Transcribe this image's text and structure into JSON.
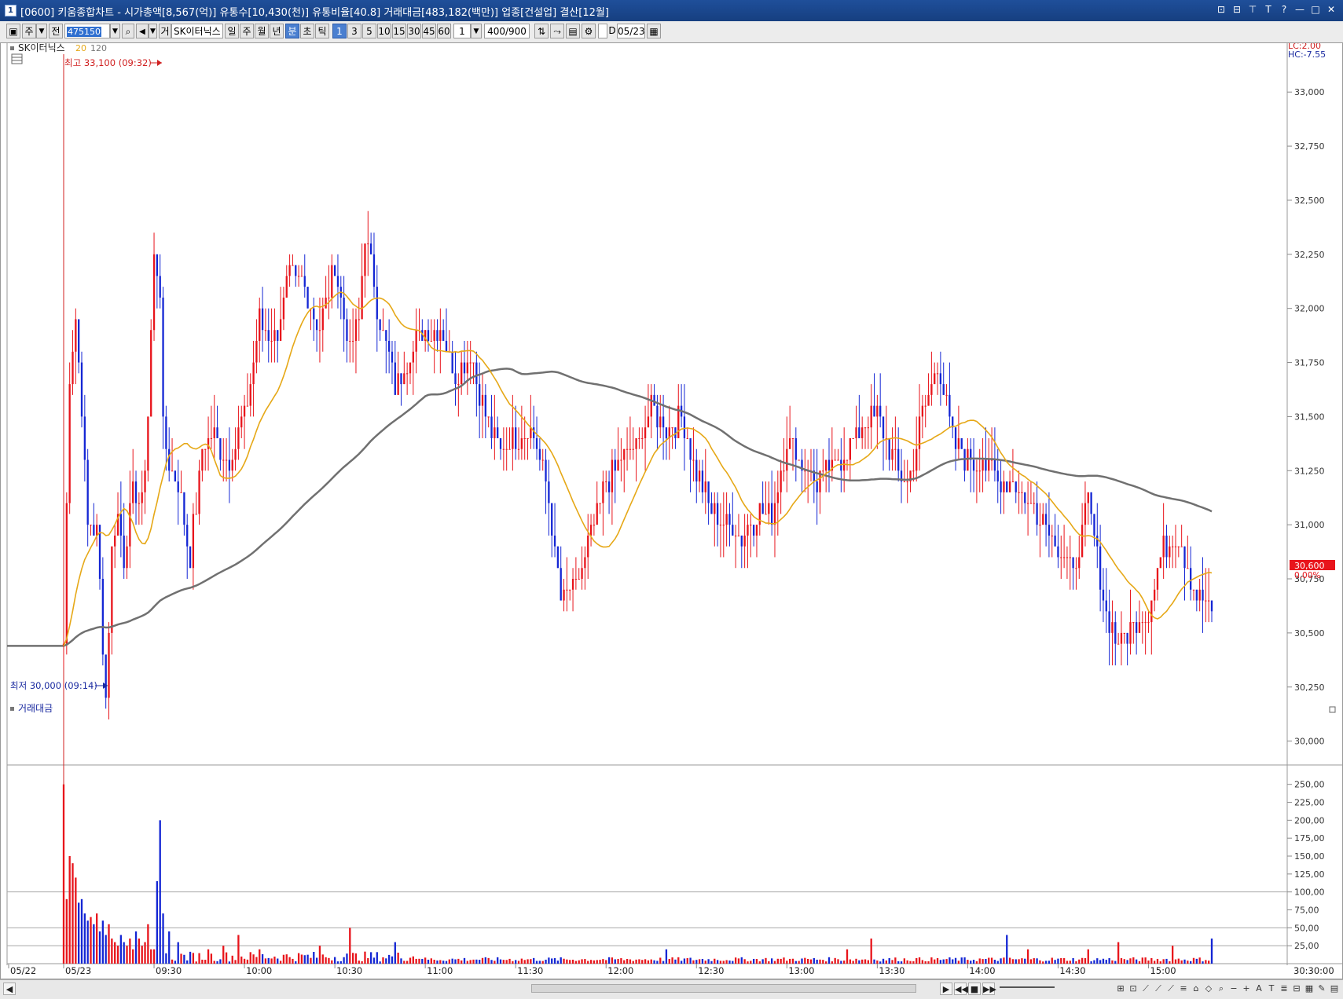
{
  "window": {
    "title": "[0600] 키움종합차트 - 시가총액[8,567(억)] 유통수[10,430(천)] 유통비율[40.8] 거래대금[483,182(백만)] 업종[건설업] 결산[12월]",
    "icon_label": "1",
    "buttons": [
      "⊡",
      "⊟",
      "⊤",
      "T",
      "?",
      "—",
      "□",
      "✕"
    ]
  },
  "toolbar": {
    "period_type": "주",
    "compare": "전",
    "stock_code": "475150",
    "search_icon": "search-icon",
    "sound_icon": "speaker-icon",
    "stock_name_prefix": "거",
    "stock_name": "SK이터닉스",
    "timeframes": [
      "일",
      "주",
      "월",
      "년",
      "분",
      "초",
      "틱"
    ],
    "active_timeframe": "분",
    "intervals": [
      "1",
      "3",
      "5",
      "10",
      "15",
      "30",
      "45",
      "60"
    ],
    "active_interval": "1",
    "interval_select": "1",
    "count_display": "400/900",
    "date_check_label": "D",
    "date_value": "05/23"
  },
  "chart": {
    "stock_label": "SK이터닉스",
    "ma_labels": [
      "20",
      "120"
    ],
    "high_label": "최고 33,100 (09:32)",
    "low_label": "최저 30,000 (09:14)",
    "lc_label": "LC:2.00",
    "hc_label": "HC:-7.55",
    "current_price": "30,600",
    "current_change": "0.00%",
    "volume_panel_label": "거래대금",
    "time_range": "30:30:00",
    "colors": {
      "up": "#e8141b",
      "down": "#1426d4",
      "ma20": "#e6a817",
      "ma120": "#707070",
      "hiline": "#d02020"
    }
  },
  "chart_data": {
    "type": "candlestick",
    "title": "",
    "price_axis": {
      "ticks": [
        33000,
        32750,
        32500,
        32250,
        32000,
        31750,
        31500,
        31250,
        31000,
        30750,
        30500,
        30250,
        30000
      ],
      "tick_labels": [
        "33,000",
        "32,750",
        "32,500",
        "32,250",
        "32,000",
        "31,750",
        "31,500",
        "31,250",
        "31,000",
        "30,750",
        "30,500",
        "30,250",
        "30,000"
      ],
      "ylim": [
        29995,
        33175
      ]
    },
    "volume_axis": {
      "ticks": [
        250,
        225,
        200,
        175,
        150,
        125,
        100,
        75,
        50,
        25
      ],
      "tick_labels": [
        "250,00",
        "225,00",
        "200,00",
        "175,00",
        "150,00",
        "125,00",
        "100,00",
        "75,00",
        "50,00",
        "25,00"
      ],
      "ylim": [
        0,
        265
      ]
    },
    "time_axis": {
      "labels": [
        "05/22",
        "05/23",
        "09:30",
        "10:00",
        "10:30",
        "11:00",
        "11:30",
        "12:00",
        "12:30",
        "13:00",
        "13:30",
        "14:00",
        "14:30",
        "15:00"
      ],
      "label_minutes": [
        -999,
        0,
        30,
        60,
        90,
        120,
        150,
        180,
        210,
        240,
        270,
        300,
        330,
        360
      ],
      "xlim_minutes": [
        -18,
        402
      ],
      "last_minute": 381
    },
    "series_names": [
      "SK이터닉스",
      "20",
      "120",
      "거래대금"
    ],
    "price_anchor": {
      "minutes": [
        0,
        2,
        4,
        6,
        8,
        11,
        14,
        16,
        18,
        20,
        23,
        26,
        28,
        30,
        32,
        33,
        35,
        38,
        42,
        46,
        50,
        55,
        60,
        65,
        70,
        75,
        80,
        85,
        90,
        95,
        98,
        100,
        105,
        110,
        115,
        120,
        125,
        130,
        135,
        140,
        145,
        150,
        155,
        160,
        165,
        170,
        175,
        180,
        185,
        190,
        195,
        200,
        205,
        210,
        215,
        220,
        225,
        230,
        235,
        240,
        245,
        250,
        255,
        260,
        265,
        270,
        275,
        280,
        285,
        290,
        295,
        300,
        305,
        310,
        315,
        320,
        325,
        330,
        335,
        340,
        345,
        350,
        355,
        360,
        365,
        370,
        375,
        381
      ],
      "closes": [
        30440,
        31700,
        31950,
        31550,
        31000,
        30980,
        30200,
        30900,
        31050,
        30850,
        31150,
        31100,
        31500,
        32250,
        32100,
        31450,
        31300,
        31200,
        30850,
        31350,
        31400,
        31300,
        31500,
        31950,
        31850,
        32150,
        32100,
        31900,
        32200,
        31800,
        31950,
        32350,
        31950,
        31650,
        31800,
        31900,
        31900,
        31700,
        31800,
        31500,
        31350,
        31400,
        31450,
        31200,
        30650,
        30700,
        30950,
        31200,
        31300,
        31350,
        31550,
        31450,
        31500,
        31250,
        31050,
        31000,
        30950,
        31050,
        31050,
        31400,
        31300,
        31200,
        31250,
        31350,
        31450,
        31500,
        31300,
        31200,
        31500,
        31750,
        31400,
        31300,
        31300,
        31200,
        31200,
        31100,
        31050,
        30900,
        30750,
        31100,
        30650,
        30450,
        30550,
        30600,
        30900,
        30950,
        30700,
        30600
      ]
    },
    "ma20_end": 30790,
    "ma120_end": 31080,
    "volume_spikes": {
      "minutes": [
        0,
        1,
        2,
        3,
        4,
        5,
        6,
        7,
        8,
        9,
        10,
        11,
        12,
        13,
        14,
        15,
        16,
        17,
        18,
        19,
        20,
        21,
        22,
        23,
        24,
        25,
        26,
        27,
        28,
        29,
        30,
        31,
        32,
        33,
        35,
        38,
        48,
        53,
        58,
        65,
        85,
        95,
        110,
        200,
        260,
        268,
        313,
        320,
        340,
        350,
        368,
        381
      ],
      "values": [
        250,
        90,
        150,
        140,
        120,
        85,
        90,
        70,
        60,
        65,
        55,
        70,
        45,
        60,
        40,
        55,
        35,
        30,
        25,
        40,
        30,
        25,
        35,
        20,
        45,
        35,
        25,
        30,
        55,
        20,
        20,
        115,
        200,
        70,
        45,
        30,
        20,
        25,
        40,
        20,
        25,
        50,
        30,
        20,
        20,
        35,
        40,
        20,
        20,
        30,
        25,
        35
      ]
    }
  }
}
